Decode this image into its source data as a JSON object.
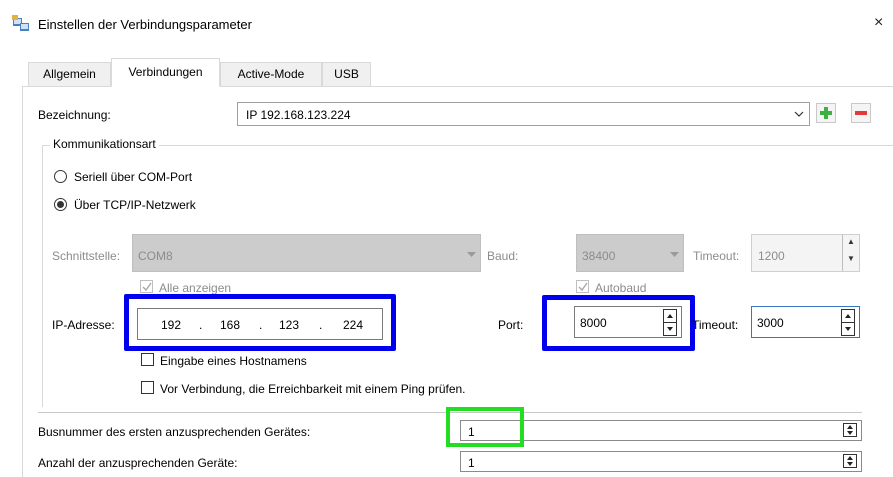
{
  "window": {
    "title": "Einstellen der Verbindungsparameter",
    "close_label": "×"
  },
  "tabs": [
    "Allgemein",
    "Verbindungen",
    "Active-Mode",
    "USB"
  ],
  "bezeichnung": {
    "label": "Bezeichnung:",
    "value": "IP 192.168.123.224",
    "add_label": "+",
    "remove_label": "−"
  },
  "kommunikation": {
    "group_label": "Kommunikationsart",
    "radio_serial": "Seriell über COM-Port",
    "radio_tcp": "Über TCP/IP-Netzwerk",
    "selected": "tcp"
  },
  "serial": {
    "schnittstelle_label": "Schnittstelle:",
    "schnittstelle_value": "COM8",
    "baud_label": "Baud:",
    "baud_value": "38400",
    "timeout_label": "Timeout:",
    "timeout_value": "1200",
    "alle_anzeigen": "Alle anzeigen",
    "autobaud": "Autobaud"
  },
  "tcp": {
    "ip_label": "IP-Adresse:",
    "ip": [
      "192",
      "168",
      "123",
      "224"
    ],
    "dot": ".",
    "port_label": "Port:",
    "port_value": "8000",
    "timeout_label": "Timeout:",
    "timeout_value": "3000",
    "hostname_label": "Eingabe eines Hostnamens",
    "ping_label": "Vor Verbindung, die Erreichbarkeit mit einem Ping prüfen."
  },
  "bus": {
    "first_label": "Busnummer des ersten anzusprechenden Gerätes:",
    "first_value": "1",
    "count_label": "Anzahl der anzusprechenden Geräte:",
    "count_value": "1"
  },
  "colors": {
    "highlight_blue": "#0000ee",
    "highlight_green": "#22dd22",
    "add_green": "#3cb043",
    "remove_red": "#e03a3a"
  }
}
